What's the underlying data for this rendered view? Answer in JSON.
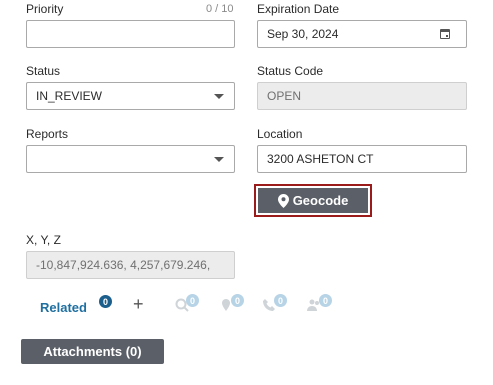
{
  "form": {
    "priority": {
      "label": "Priority",
      "counter": "0 / 10",
      "value": ""
    },
    "expiration": {
      "label": "Expiration Date",
      "value": "Sep 30, 2024"
    },
    "status": {
      "label": "Status",
      "value": "IN_REVIEW"
    },
    "status_code": {
      "label": "Status Code",
      "value": "OPEN"
    },
    "reports": {
      "label": "Reports",
      "value": ""
    },
    "location": {
      "label": "Location",
      "value": "3200 ASHETON CT"
    },
    "geocode_label": "Geocode",
    "xyz": {
      "label": "X, Y, Z",
      "value": "-10,847,924.636, 4,257,679.246,"
    }
  },
  "related": {
    "label": "Related",
    "count": "0",
    "icons": [
      {
        "name": "search-icon",
        "count": "0"
      },
      {
        "name": "pin-icon",
        "count": "0"
      },
      {
        "name": "phone-icon",
        "count": "0"
      },
      {
        "name": "people-icon",
        "count": "0"
      }
    ]
  },
  "attachments_label": "Attachments (0)"
}
